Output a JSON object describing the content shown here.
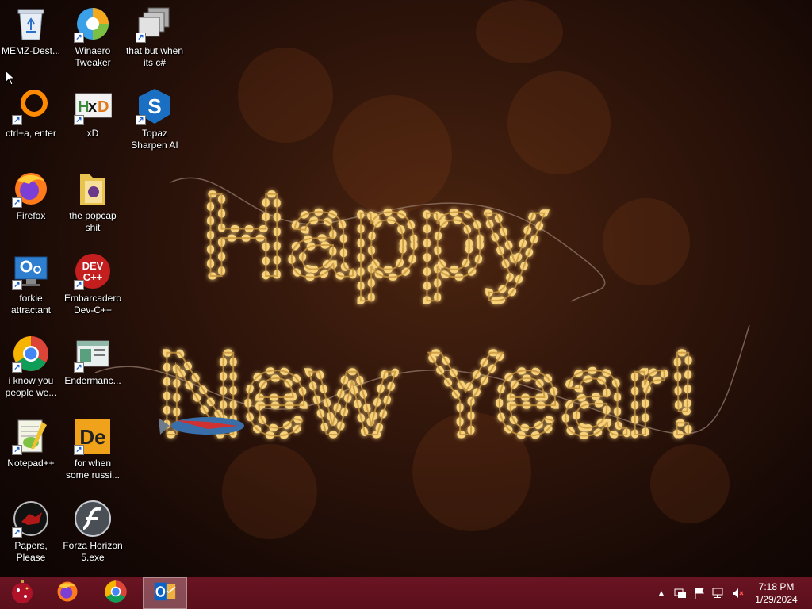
{
  "desktop": {
    "icons": [
      {
        "label": "MEMZ-Dest...",
        "icon": "recycle-bin-icon"
      },
      {
        "label": "Winaero Tweaker",
        "icon": "winaero-tweaker-icon"
      },
      {
        "label": "that but when its c#",
        "icon": "stacked-windows-icon"
      },
      {
        "label": "ctrl+a, enter",
        "icon": "orange-ring-icon"
      },
      {
        "label": "xD",
        "icon": "hxd-editor-icon"
      },
      {
        "label": "Topaz Sharpen AI",
        "icon": "topaz-sharpen-icon"
      },
      {
        "label": "Firefox",
        "icon": "firefox-icon"
      },
      {
        "label": "the popcap shit",
        "icon": "folder-icon"
      },
      {
        "label": "forkie attractant",
        "icon": "settings-monitor-icon"
      },
      {
        "label": "Embarcadero Dev-C++",
        "icon": "devcpp-icon"
      },
      {
        "label": "i know you people we...",
        "icon": "chrome-icon"
      },
      {
        "label": "Endermanc...",
        "icon": "window-app-icon"
      },
      {
        "label": "Notepad++",
        "icon": "notepadpp-icon"
      },
      {
        "label": "for when some russi...",
        "icon": "de-app-icon"
      },
      {
        "label": "Papers, Please",
        "icon": "papers-please-icon"
      },
      {
        "label": "Forza Horizon 5.exe",
        "icon": "flash-player-icon"
      }
    ]
  },
  "wallpaper": {
    "greeting_line1": "Happy",
    "greeting_line2": "New Year!"
  },
  "taskbar": {
    "pinned": [
      {
        "icon": "start-ornament-icon"
      },
      {
        "icon": "firefox-icon"
      },
      {
        "icon": "chrome-icon"
      },
      {
        "icon": "outlook-icon",
        "active": true
      }
    ],
    "tray": [
      "chevron-up-icon",
      "network-status-icon",
      "flag-icon",
      "network-icon",
      "volume-muted-icon"
    ],
    "clock": {
      "time": "7:18 PM",
      "date": "1/29/2024"
    }
  },
  "colors": {
    "taskbar": "#5a0f1b",
    "accent_light": "#f7d27a"
  }
}
